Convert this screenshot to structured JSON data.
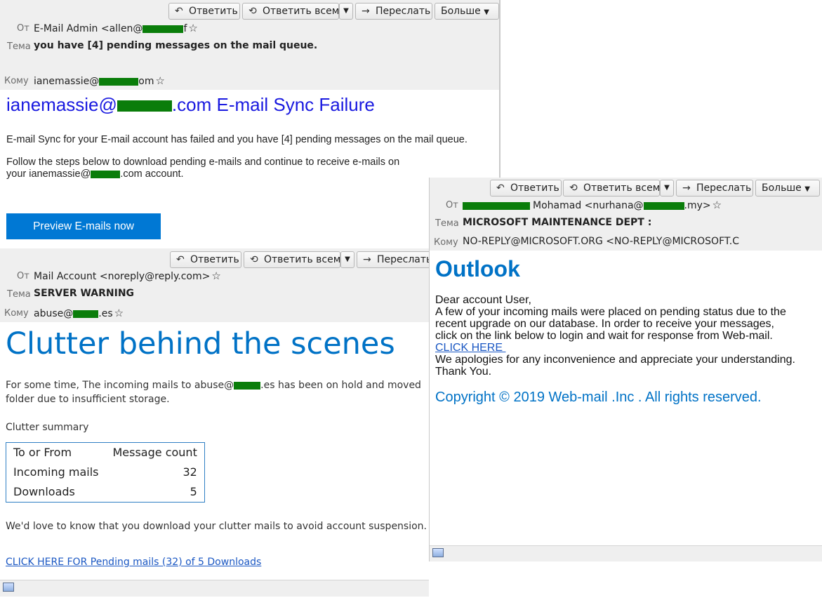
{
  "toolbar": {
    "reply": "Ответить",
    "reply_all": "Ответить всем",
    "forward": "Переслать",
    "more": "Больше",
    "reply_icon": "reply-icon",
    "reply_all_icon": "reply-all-icon",
    "forward_icon": "forward-icon",
    "dropdown_icon": "chevron-down-icon"
  },
  "labels": {
    "from": "От",
    "subject": "Тема",
    "to": "Кому"
  },
  "email1": {
    "from_a": "E-Mail Admin <allen@",
    "from_b": "f",
    "subject": "you have [4] pending messages on the mail queue.",
    "to_a": "ianemassie@",
    "to_b": "om",
    "heading_a": "ianemassie@",
    "heading_b": ".com E-mail Sync Failure",
    "para1": "E-mail Sync for your E-mail account has failed and you have [4] pending messages on the mail queue.",
    "para2_line1": "Follow the steps below to download pending e-mails and continue to receive e-mails on",
    "para2_a": "your ianemassie@",
    "para2_b": ".com account.",
    "button": "Preview E-mails now",
    "accent_color": "#0078d4"
  },
  "email2": {
    "from": "Mail Account <noreply@reply.com>",
    "subject": "SERVER WARNING",
    "to_a": "abuse@",
    "to_b": ".es",
    "heading": "Clutter behind the scenes",
    "para1_a": "For some time, The incoming mails to abuse@",
    "para1_b": ".es  has been on hold and moved",
    "para1_line2": "folder due to insufficient storage.",
    "summary_label": "Clutter summary",
    "table": {
      "headers": [
        "To or From",
        "Message count"
      ],
      "rows": [
        [
          "Incoming mails",
          "32"
        ],
        [
          "Downloads",
          "5"
        ]
      ]
    },
    "para2": "We'd love to know that you download your clutter mails to avoid account suspension.",
    "link": "CLICK HERE FOR Pending mails (32) of 5 Downloads",
    "heading_color": "#0072c6"
  },
  "email3": {
    "from_a": "Mohamad <nurhana@",
    "from_b": ".my>",
    "subject": "MICROSOFT MAINTENANCE DEPT :",
    "to": "NO-REPLY@MICROSOFT.ORG <NO-REPLY@MICROSOFT.C",
    "heading": "Outlook",
    "greeting": "Dear account User,",
    "line1": "A few of your incoming mails were placed on pending status due to the",
    "line2": "recent upgrade on our database. In order to receive your messages,",
    "line3": "click on the link below to login and wait for response from Web-mail.",
    "link": "CLICK HERE ",
    "line4": "We apologies for any inconvenience and appreciate your understanding.",
    "line5": "Thank You.",
    "copyright": "Copyright © 2019 Web-mail .Inc . All rights reserved.",
    "heading_color": "#0072c6"
  },
  "icons": {
    "star": "star-icon",
    "status": "connection-status-icon"
  }
}
